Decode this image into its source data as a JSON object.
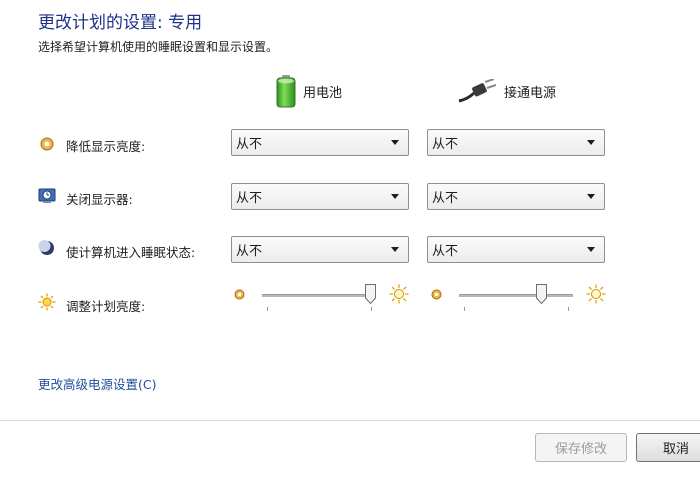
{
  "header": {
    "title": "更改计划的设置: 专用",
    "subtitle": "选择希望计算机使用的睡眠设置和显示设置。"
  },
  "columns": {
    "battery": {
      "label": "用电池",
      "icon": "battery-icon"
    },
    "plugged": {
      "label": "接通电源",
      "icon": "power-plug-icon"
    }
  },
  "rows": [
    {
      "label": "降低显示亮度:",
      "icon": "dim-display-icon",
      "battery_value": "从不",
      "plugged_value": "从不"
    },
    {
      "label": "关闭显示器:",
      "icon": "display-off-icon",
      "battery_value": "从不",
      "plugged_value": "从不"
    },
    {
      "label": "使计算机进入睡眠状态:",
      "icon": "sleep-moon-icon",
      "battery_value": "从不",
      "plugged_value": "从不"
    }
  ],
  "brightness": {
    "label": "调整计划亮度:",
    "icon": "brightness-sun-icon",
    "battery_level": 1.0,
    "plugged_level": 0.75
  },
  "links": {
    "advanced": "更改高级电源设置(C)"
  },
  "buttons": {
    "save": "保存修改",
    "cancel": "取消"
  },
  "colors": {
    "title": "#1e3287",
    "link": "#1f4f9e",
    "battery_green": "#3fae2a"
  }
}
